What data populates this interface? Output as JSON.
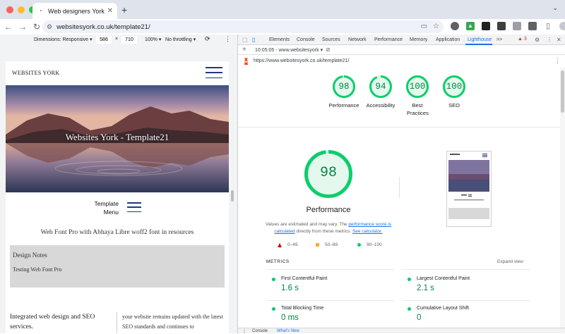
{
  "browser": {
    "tab_title": "Web designers York - Template",
    "tab_favicon": "browser-favicon",
    "address": "websitesyork.co.uk/template21/",
    "new_tab_label": "+"
  },
  "device_toolbar": {
    "dimensions": "Dimensions: Responsive",
    "width": "586",
    "height": "710",
    "x_sep": "×",
    "zoom": "100%",
    "throttling": "No throttling"
  },
  "devtools": {
    "tabs": [
      "Elements",
      "Console",
      "Sources",
      "Network",
      "Performance",
      "Memory",
      "Application",
      "Lighthouse",
      ">>"
    ],
    "active_tab": "Lighthouse",
    "warning_count": "3",
    "report_time": "10:05:05 - www.websitesyork",
    "report_url": "https://www.websitesyork.co.uk/template21/",
    "drawer_tabs": [
      "Console",
      "What's New"
    ]
  },
  "site": {
    "brand": "WEBSITES YORK",
    "hero_title": "Websites York - Template21",
    "template_menu_line1": "Template",
    "template_menu_line2": "Menu",
    "subtitle": "Web Font Pro with Abhaya Libre woff2 font in resources",
    "notes_heading": "Design Notes",
    "notes_text": "Testing Web Font Pro",
    "col_left": "Integrated web design and SEO services.",
    "col_right": "your website remains updated with the latest SEO standards and continues to"
  },
  "lighthouse": {
    "scores": [
      {
        "label": "Performance",
        "value": "98",
        "score": 98
      },
      {
        "label": "Accessibility",
        "value": "94",
        "score": 94
      },
      {
        "label": "Best Practices",
        "value": "100",
        "score": 100
      },
      {
        "label": "SEO",
        "value": "100",
        "score": 100
      }
    ],
    "perf_value": "98",
    "perf_title": "Performance",
    "desc_pre": "Values are estimated and may vary. The ",
    "desc_link1": "performance score is calculated",
    "desc_mid": " directly from these metrics. ",
    "desc_link2": "See calculator.",
    "legend": [
      "0–49",
      "50–89",
      "90–100"
    ],
    "metrics_header": "METRICS",
    "expand_label": "Expand view",
    "metrics": [
      {
        "name": "First Contentful Paint",
        "value": "1.6 s"
      },
      {
        "name": "Largest Contentful Paint",
        "value": "2.1 s"
      },
      {
        "name": "Total Blocking Time",
        "value": "0 ms"
      },
      {
        "name": "Cumulative Layout Shift",
        "value": "0"
      }
    ],
    "colors": {
      "pass": "#0cce6b",
      "pass_text": "#018642",
      "average": "#ffaa33",
      "fail": "#cc0000",
      "link": "#1a73e8"
    }
  }
}
